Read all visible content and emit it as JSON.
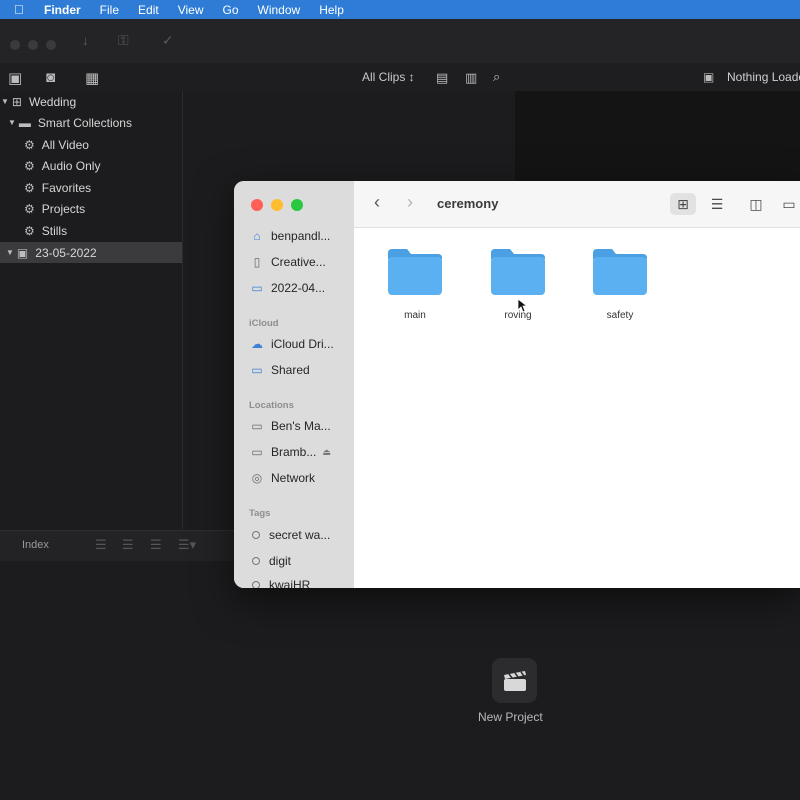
{
  "menubar": {
    "apple_icon": "apple-logo-icon",
    "items": [
      "Finder",
      "File",
      "Edit",
      "View",
      "Go",
      "Window",
      "Help"
    ]
  },
  "library": {
    "filter_label": "All Clips",
    "items": [
      {
        "label": "Wedding",
        "icon": "library-icon",
        "level": 0
      },
      {
        "label": "Smart Collections",
        "icon": "folder-icon",
        "level": 1
      },
      {
        "label": "All Video",
        "icon": "gear-icon",
        "level": 2
      },
      {
        "label": "Audio Only",
        "icon": "gear-icon",
        "level": 2
      },
      {
        "label": "Favorites",
        "icon": "gear-icon",
        "level": 2
      },
      {
        "label": "Projects",
        "icon": "gear-icon",
        "level": 2
      },
      {
        "label": "Stills",
        "icon": "gear-icon",
        "level": 2
      },
      {
        "label": "23-05-2022",
        "icon": "event-icon",
        "level": 0,
        "selected": true
      }
    ]
  },
  "viewer": {
    "status": "Nothing Loaded"
  },
  "bottombar": {
    "index_label": "Index"
  },
  "timeline": {
    "new_project_label": "New Project"
  },
  "finder": {
    "title": "ceremony",
    "sidebar": {
      "favorites": [
        {
          "label": "benpandl...",
          "icon": "home-icon"
        },
        {
          "label": "Creative...",
          "icon": "document-icon"
        },
        {
          "label": "2022-04...",
          "icon": "folder-icon"
        }
      ],
      "icloud_header": "iCloud",
      "icloud": [
        {
          "label": "iCloud Dri...",
          "icon": "cloud-icon"
        },
        {
          "label": "Shared",
          "icon": "shared-folder-icon"
        }
      ],
      "locations_header": "Locations",
      "locations": [
        {
          "label": "Ben's Ma...",
          "icon": "laptop-icon"
        },
        {
          "label": "Bramb...",
          "icon": "disk-icon"
        },
        {
          "label": "Network",
          "icon": "network-icon"
        }
      ],
      "tags_header": "Tags",
      "tags": [
        {
          "label": "secret wa..."
        },
        {
          "label": "digit"
        },
        {
          "label": "kwaiHR"
        }
      ]
    },
    "folders": [
      "main",
      "roving",
      "safety"
    ],
    "colors": {
      "folder_fill": "#5ab0f0",
      "folder_tab": "#4aa0e2",
      "close": "#ff5f57",
      "minimize": "#febc2e",
      "zoom": "#28c840"
    }
  }
}
